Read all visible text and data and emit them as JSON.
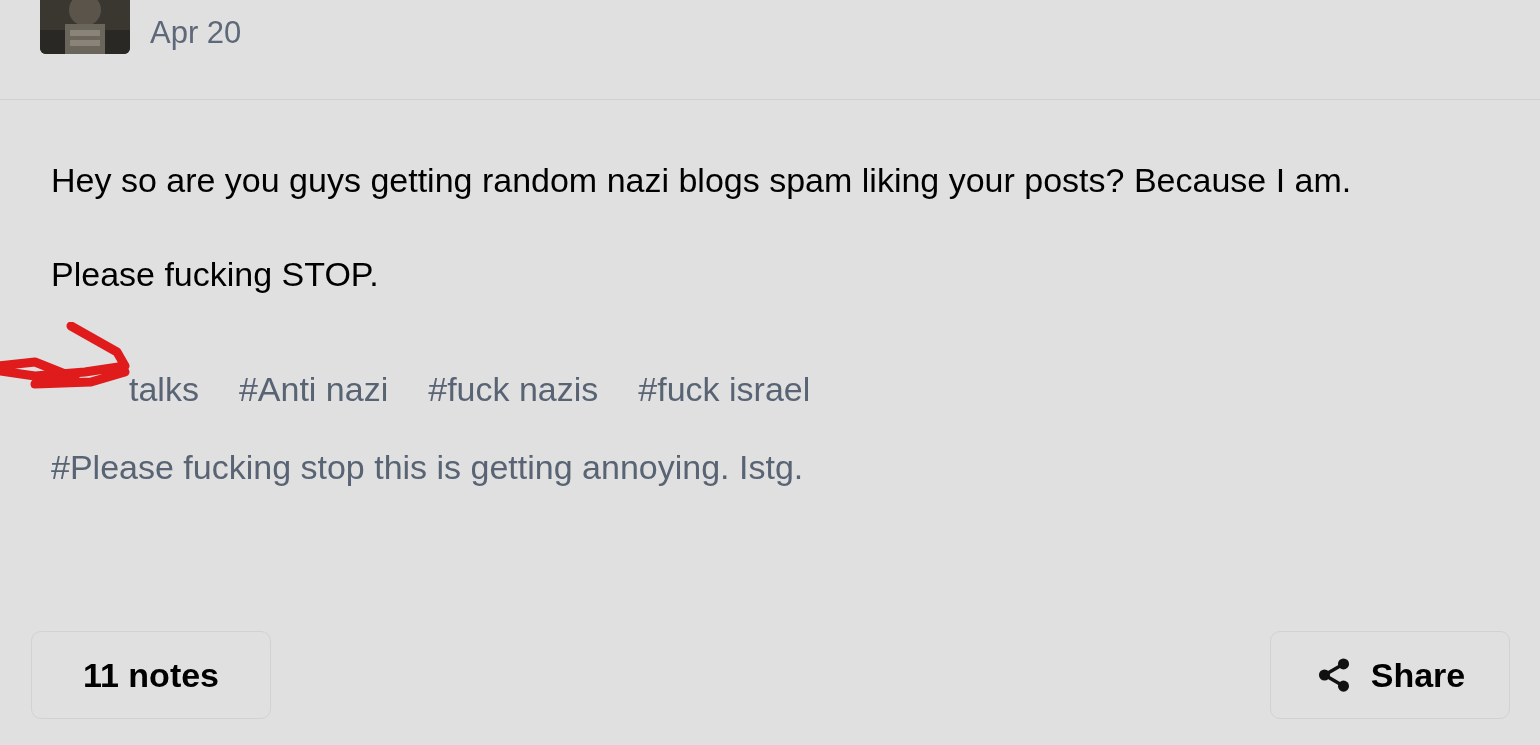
{
  "post": {
    "date": "Apr 20",
    "paragraphs": [
      "Hey so are you guys getting random nazi blogs spam liking your posts? Because I am.",
      "Please fucking STOP."
    ],
    "tags": [
      {
        "label": "talks",
        "scribbled": true
      },
      {
        "label": "#Anti nazi",
        "scribbled": false
      },
      {
        "label": "#fuck nazis",
        "scribbled": false
      },
      {
        "label": "#fuck israel",
        "scribbled": false
      },
      {
        "label": "#Please fucking stop this is getting annoying. Istg.",
        "scribbled": false
      }
    ],
    "notes": "11 notes",
    "share": "Share"
  }
}
